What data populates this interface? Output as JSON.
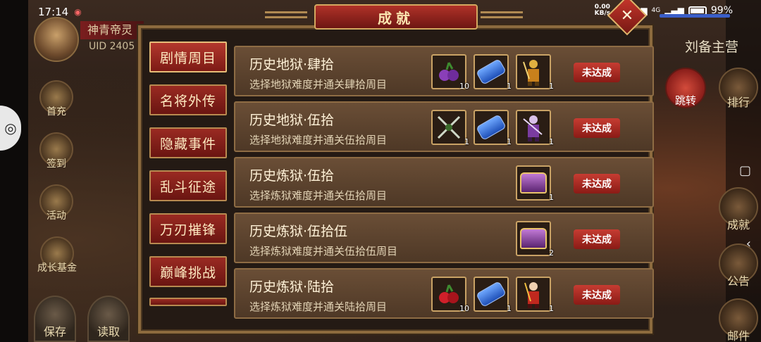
{
  "status_bar": {
    "time": "17:14",
    "net_speed_value": "0.00",
    "net_speed_unit": "KB/s",
    "signal_1": "4G",
    "signal_2": "4G",
    "battery": "99%"
  },
  "player": {
    "name": "神青帝灵",
    "uid": "UID 2405"
  },
  "background_left_buttons": [
    {
      "label": "首充"
    },
    {
      "label": "签到"
    },
    {
      "label": "活动"
    },
    {
      "label": "成长基金"
    }
  ],
  "background_bottom_buttons": [
    {
      "label": "保存"
    },
    {
      "label": "读取"
    }
  ],
  "background_right": {
    "camp_label": "刘备主营",
    "jump_label": "跳转",
    "buttons": [
      {
        "label": "排行"
      },
      {
        "label": "成就"
      },
      {
        "label": "公告"
      },
      {
        "label": "邮件"
      }
    ]
  },
  "dialog": {
    "title": "成就",
    "close_glyph": "✕",
    "categories": [
      {
        "label": "剧情周目",
        "active": true
      },
      {
        "label": "名将外传",
        "active": false
      },
      {
        "label": "隐藏事件",
        "active": false
      },
      {
        "label": "乱斗征途",
        "active": false
      },
      {
        "label": "万刃摧锋",
        "active": false
      },
      {
        "label": "巅峰挑战",
        "active": false
      }
    ],
    "achievements": [
      {
        "title": "历史地狱·肆拾",
        "desc": "选择地狱难度并通关肆拾周目",
        "status": "未达成",
        "rewards": [
          {
            "icon": "purple-fruit-icon",
            "qty": "10"
          },
          {
            "icon": "blue-scroll-icon",
            "qty": "1"
          },
          {
            "icon": "golden-warrior-icon",
            "qty": "1"
          }
        ]
      },
      {
        "title": "历史地狱·伍拾",
        "desc": "选择地狱难度并通关伍拾周目",
        "status": "未达成",
        "rewards": [
          {
            "icon": "crossed-swords-icon",
            "qty": "1"
          },
          {
            "icon": "blue-scroll-icon",
            "qty": "1"
          },
          {
            "icon": "purple-warrior-icon",
            "qty": "1"
          }
        ]
      },
      {
        "title": "历史炼狱·伍拾",
        "desc": "选择炼狱难度并通关伍拾周目",
        "status": "未达成",
        "rewards": [
          {
            "icon": "purple-chest-icon",
            "qty": "1"
          }
        ]
      },
      {
        "title": "历史炼狱·伍拾伍",
        "desc": "选择炼狱难度并通关伍拾伍周目",
        "status": "未达成",
        "rewards": [
          {
            "icon": "purple-chest-icon",
            "qty": "2"
          }
        ]
      },
      {
        "title": "历史炼狱·陆拾",
        "desc": "选择炼狱难度并通关陆拾周目",
        "status": "未达成",
        "rewards": [
          {
            "icon": "red-fruit-icon",
            "qty": "10"
          },
          {
            "icon": "blue-scroll-icon",
            "qty": "1"
          },
          {
            "icon": "red-warrior-icon",
            "qty": "1"
          }
        ]
      }
    ]
  },
  "colors": {
    "accent_red": "#9a2a22",
    "gold_border": "#c9a265",
    "row_bg": "#5c4430"
  }
}
